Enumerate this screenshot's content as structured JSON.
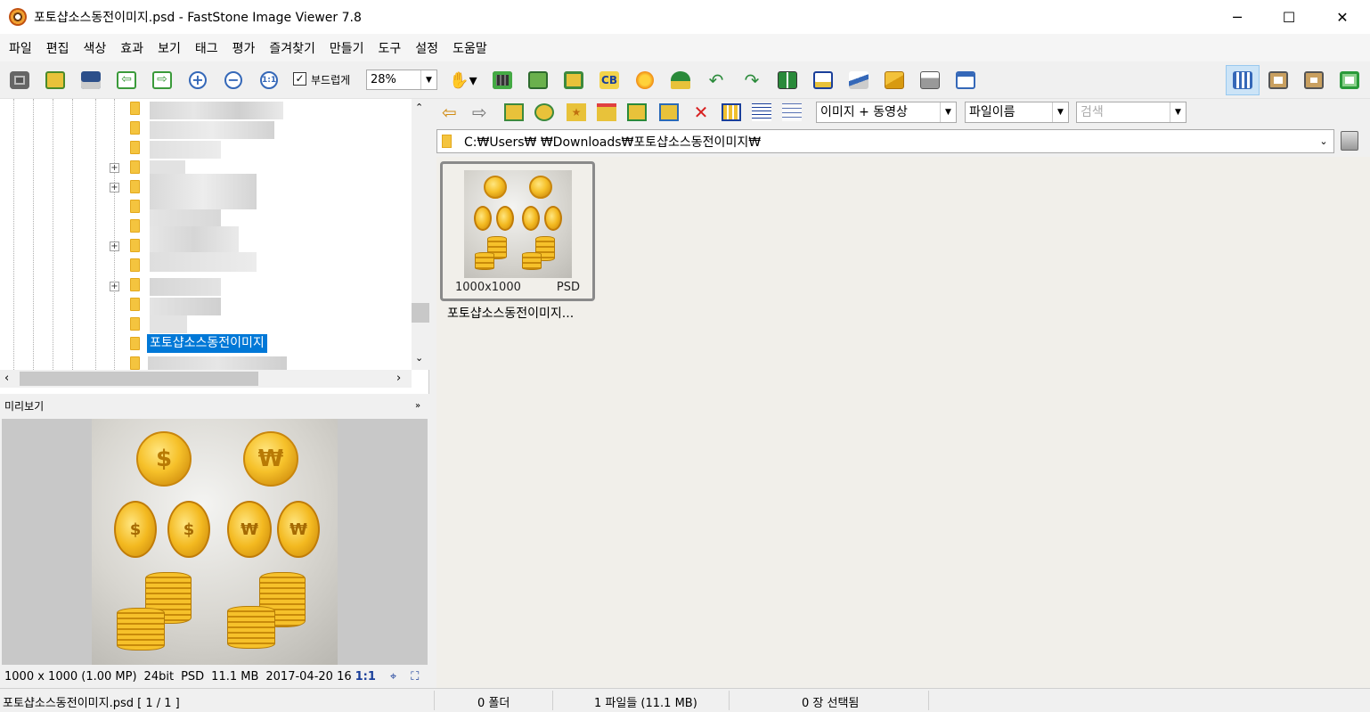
{
  "window": {
    "title": "포토샵소스동전이미지.psd  -  FastStone Image Viewer 7.8",
    "min_glyph": "─",
    "max_glyph": "☐",
    "close_glyph": "✕"
  },
  "menu": [
    "파일",
    "편집",
    "색상",
    "효과",
    "보기",
    "태그",
    "평가",
    "즐겨찾기",
    "만들기",
    "도구",
    "설정",
    "도움말"
  ],
  "toolbar": {
    "smooth_checked": "✓",
    "smooth_label": "부드럽게",
    "zoom_value": "28%"
  },
  "folder_tree": {
    "selected_folder": "포토샵소스동전이미지"
  },
  "filter": {
    "type_filter": "이미지 + 동영상",
    "sort_by": "파일이름",
    "search_placeholder": "검색"
  },
  "path": {
    "value": "C:₩Users₩      ₩Downloads₩포토샵소스동전이미지₩"
  },
  "thumbnail": {
    "dimensions": "1000x1000",
    "format": "PSD",
    "filename": "포토샵소스동전이미지..."
  },
  "preview": {
    "header": "미리보기",
    "dimensions": "1000 x 1000 (1.00 MP)",
    "bitdepth": "24bit",
    "format": "PSD",
    "size": "11.1 MB",
    "date": "2017-04-20 16",
    "ratio": "1:1",
    "coin_dollar": "$",
    "coin_won": "₩"
  },
  "status": {
    "file": "포토샵소스동전이미지.psd [ 1 / 1 ]",
    "folders": "0 폴더",
    "files": "1 파일들 (11.1 MB)",
    "selected": "0 장 선택됨"
  },
  "colors": {
    "selection": "#0078d7",
    "coin_gold": "#f6c12a",
    "active_view": "#cce4f7"
  }
}
